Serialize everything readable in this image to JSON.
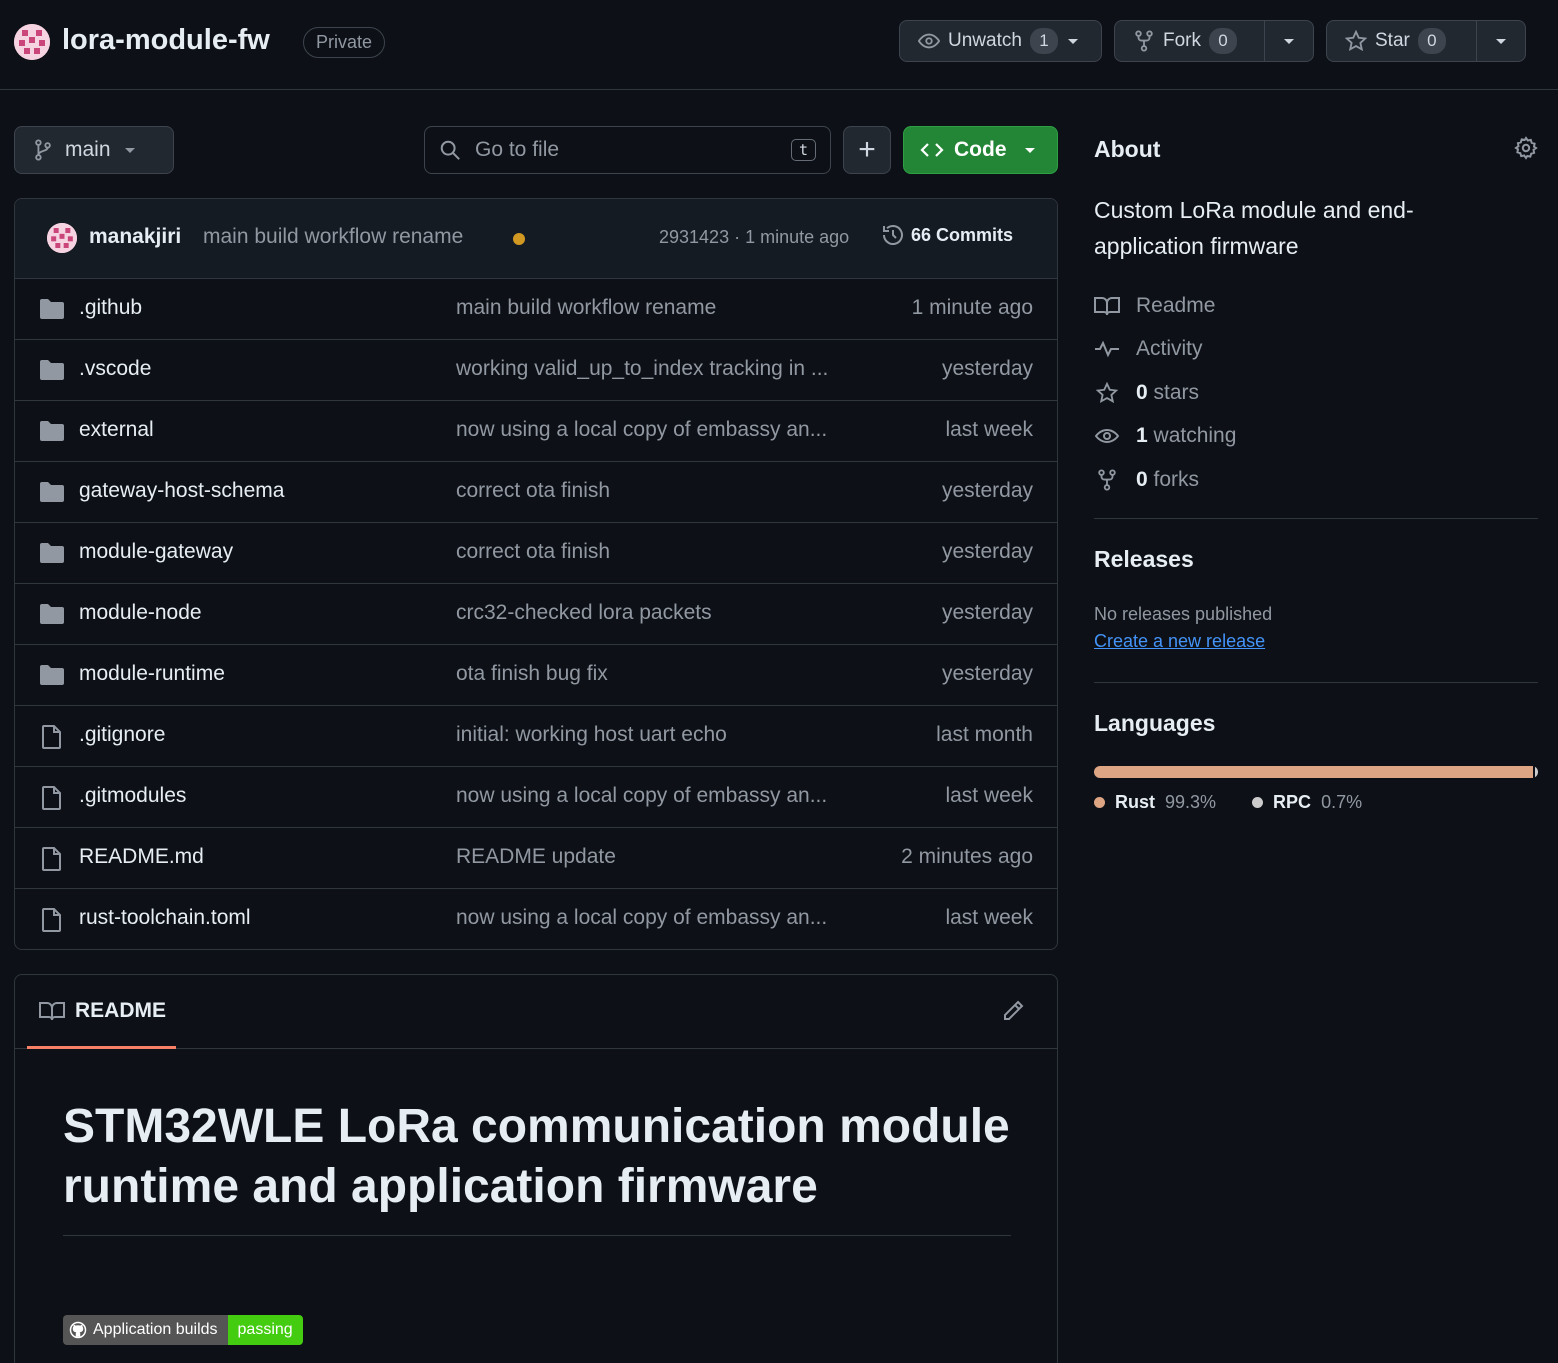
{
  "repo": {
    "name": "lora-module-fw",
    "visibility": "Private"
  },
  "header_actions": {
    "unwatch_label": "Unwatch",
    "watch_count": "1",
    "fork_label": "Fork",
    "fork_count": "0",
    "star_label": "Star",
    "star_count": "0"
  },
  "toolbar": {
    "branch": "main",
    "search_placeholder": "Go to file",
    "search_shortcut": "t",
    "add_label": "+",
    "code_label": "Code"
  },
  "latest_commit": {
    "author": "manakjiri",
    "message": "main build workflow rename",
    "status_color": "#d29922",
    "meta": "2931423 · 1 minute ago",
    "commits_label": "66 Commits"
  },
  "files": [
    {
      "type": "folder",
      "name": ".github",
      "message": "main build workflow rename",
      "time": "1 minute ago"
    },
    {
      "type": "folder",
      "name": ".vscode",
      "message": "working valid_up_to_index tracking in ...",
      "time": "yesterday"
    },
    {
      "type": "folder",
      "name": "external",
      "message": "now using a local copy of embassy an...",
      "time": "last week"
    },
    {
      "type": "folder",
      "name": "gateway-host-schema",
      "message": "correct ota finish",
      "time": "yesterday"
    },
    {
      "type": "folder",
      "name": "module-gateway",
      "message": "correct ota finish",
      "time": "yesterday"
    },
    {
      "type": "folder",
      "name": "module-node",
      "message": "crc32-checked lora packets",
      "time": "yesterday"
    },
    {
      "type": "folder",
      "name": "module-runtime",
      "message": "ota finish bug fix",
      "time": "yesterday"
    },
    {
      "type": "file",
      "name": ".gitignore",
      "message": "initial: working host uart echo",
      "time": "last month"
    },
    {
      "type": "file",
      "name": ".gitmodules",
      "message": "now using a local copy of embassy an...",
      "time": "last week"
    },
    {
      "type": "file",
      "name": "README.md",
      "message": "README update",
      "time": "2 minutes ago"
    },
    {
      "type": "file",
      "name": "rust-toolchain.toml",
      "message": "now using a local copy of embassy an...",
      "time": "last week"
    }
  ],
  "readme": {
    "tab_label": "README",
    "heading": "STM32WLE LoRa communication module runtime and application firmware",
    "badge_left": "Application builds",
    "badge_right": "passing"
  },
  "about": {
    "title": "About",
    "description": "Custom LoRa module and end-application firmware",
    "readme_label": "Readme",
    "activity_label": "Activity",
    "stars_count": "0",
    "stars_label": "stars",
    "watching_count": "1",
    "watching_label": "watching",
    "forks_count": "0",
    "forks_label": "forks"
  },
  "releases": {
    "title": "Releases",
    "none_text": "No releases published",
    "create_link": "Create a new release"
  },
  "languages": {
    "title": "Languages",
    "items": [
      {
        "name": "Rust",
        "percent": "99.3%",
        "value": 99.3,
        "color": "#dea584"
      },
      {
        "name": "RPC",
        "percent": "0.7%",
        "value": 0.7,
        "color": "#cccccc"
      }
    ]
  }
}
